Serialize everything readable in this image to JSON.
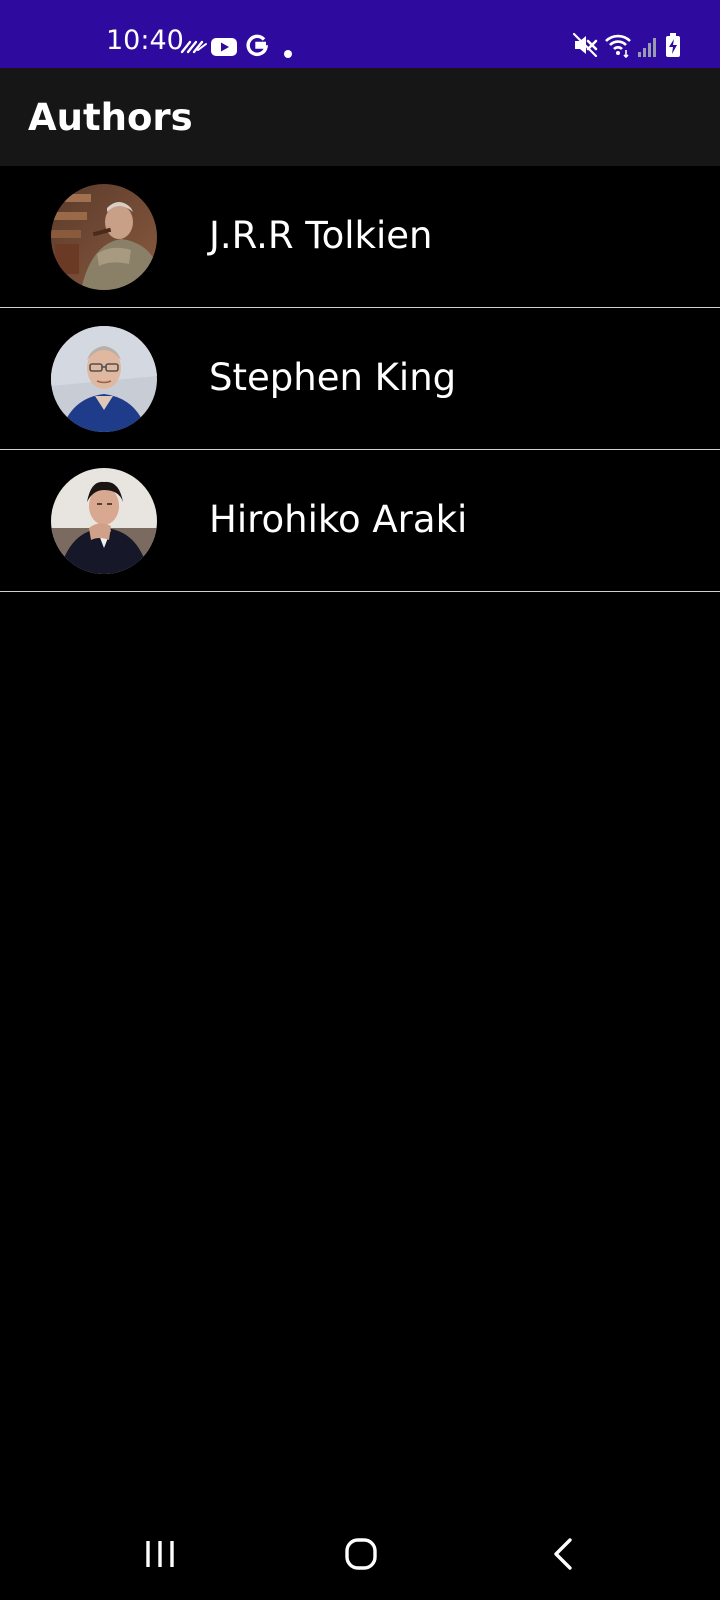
{
  "status_bar": {
    "time": "10:40",
    "left_icons": [
      "tilde-signal-icon",
      "youtube-icon",
      "google-icon",
      "dot-icon"
    ],
    "right_icons": [
      "mute-icon",
      "wifi-icon",
      "signal-bars-icon",
      "battery-charging-icon"
    ],
    "background": "#2e0b9e"
  },
  "app_bar": {
    "title": "Authors",
    "background": "#161616"
  },
  "authors": [
    {
      "name": "J.R.R Tolkien",
      "avatar": "tolkien-photo"
    },
    {
      "name": "Stephen King",
      "avatar": "stephen-king-photo"
    },
    {
      "name": "Hirohiko Araki",
      "avatar": "hirohiko-araki-photo"
    }
  ],
  "nav_bar": {
    "buttons": [
      "recent-apps-icon",
      "home-icon",
      "back-icon"
    ]
  }
}
